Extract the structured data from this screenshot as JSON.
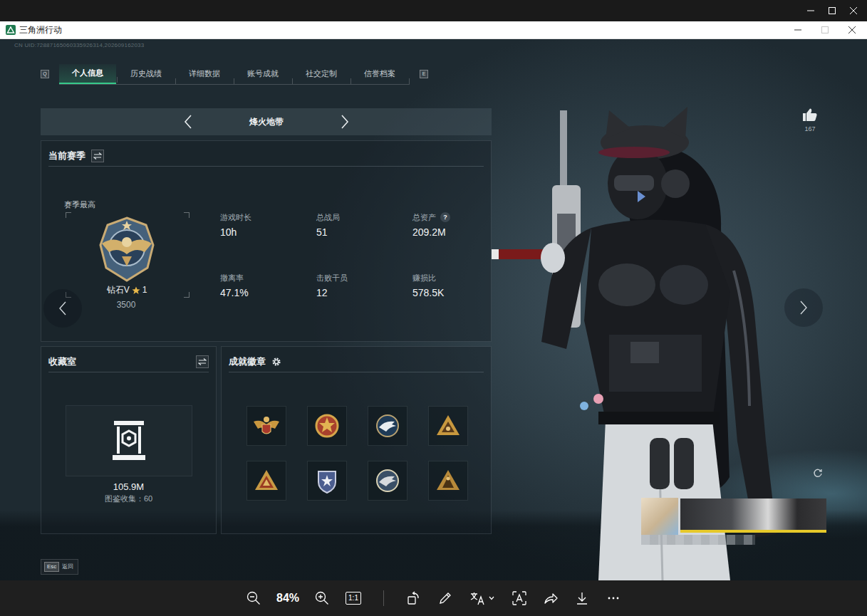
{
  "window": {
    "title": "三角洲行动",
    "maximize_disabled": true
  },
  "uid": "CN UID:72887165060335926314,202609162033",
  "tabs": {
    "prev_key": "Q",
    "next_key": "E",
    "items": [
      {
        "label": "个人信息",
        "selected": true
      },
      {
        "label": "历史战绩",
        "selected": false
      },
      {
        "label": "详细数据",
        "selected": false
      },
      {
        "label": "账号成就",
        "selected": false
      },
      {
        "label": "社交定制",
        "selected": false
      },
      {
        "label": "信誉档案",
        "selected": false
      }
    ]
  },
  "mode": {
    "label": "烽火地带"
  },
  "season": {
    "title": "当前赛季",
    "best_label": "赛季最高",
    "rank": "钻石V",
    "rank_stars": "1",
    "score": "3500",
    "stats": [
      {
        "label": "游戏时长",
        "value": "10h"
      },
      {
        "label": "总战局",
        "value": "51"
      },
      {
        "label": "总资产",
        "value": "209.2M",
        "hint": "?"
      },
      {
        "label": "撤离率",
        "value": "47.1%"
      },
      {
        "label": "击败干员",
        "value": "12"
      },
      {
        "label": "赚损比",
        "value": "578.5K"
      }
    ]
  },
  "collection": {
    "title": "收藏室",
    "value": "105.9M",
    "caption": "图鉴收集：60"
  },
  "achievements": {
    "title": "成就徽章",
    "badges": [
      {
        "kind": "crest"
      },
      {
        "kind": "medal"
      },
      {
        "kind": "eagle"
      },
      {
        "kind": "delta"
      },
      {
        "kind": "peak"
      },
      {
        "kind": "shield"
      },
      {
        "kind": "falcon"
      },
      {
        "kind": "pyramid"
      }
    ]
  },
  "profile": {
    "likes": "167"
  },
  "footer": {
    "back_key": "Esc",
    "back_label": "返回"
  },
  "viewer": {
    "zoom": "84%",
    "actual_size": "1:1"
  }
}
